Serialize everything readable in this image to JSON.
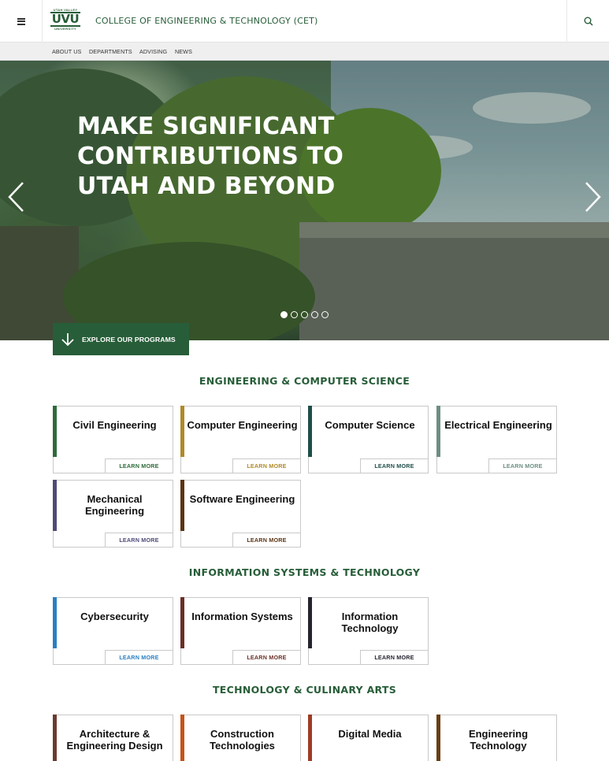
{
  "header": {
    "menu_icon": "hamburger-icon",
    "logo": {
      "top": "UTAH VALLEY",
      "main": "UVU",
      "bottom": "UNIVERSITY"
    },
    "title": "COLLEGE OF ENGINEERING & TECHNOLOGY (CET)",
    "search_icon": "search-icon"
  },
  "subnav": [
    "ABOUT US",
    "DEPARTMENTS",
    "ADVISING",
    "NEWS"
  ],
  "hero": {
    "title": "MAKE SIGNIFICANT CONTRIBUTIONS TO UTAH AND BEYOND",
    "slide_count": 5,
    "active_slide": 1
  },
  "explore_button": {
    "label": "EXPLORE OUR PROGRAMS",
    "icon": "arrow-down-icon"
  },
  "sections": [
    {
      "heading": "ENGINEERING & COMPUTER SCIENCE",
      "cards": [
        {
          "name": "Civil Engineering",
          "learn": "LEARN MORE",
          "color": "#2e6b3a"
        },
        {
          "name": "Computer Engineering",
          "learn": "LEARN MORE",
          "color": "#b08a2a"
        },
        {
          "name": "Computer Science",
          "learn": "LEARN MORE",
          "color": "#1f4e4a"
        },
        {
          "name": "Electrical Engineering",
          "learn": "LEARN MORE",
          "color": "#6e8e82"
        },
        {
          "name": "Mechanical Engineering",
          "learn": "LEARN MORE",
          "color": "#4e4b78"
        },
        {
          "name": "Software Engineering",
          "learn": "LEARN MORE",
          "color": "#5b3414"
        }
      ]
    },
    {
      "heading": "INFORMATION SYSTEMS & TECHNOLOGY",
      "cards": [
        {
          "name": "Cybersecurity",
          "learn": "LEARN MORE",
          "color": "#2b7fc1"
        },
        {
          "name": "Information Systems",
          "learn": "LEARN MORE",
          "color": "#6b2f27"
        },
        {
          "name": "Information Technology",
          "learn": "LEARN MORE",
          "color": "#26232f"
        }
      ]
    },
    {
      "heading": "TECHNOLOGY & CULINARY ARTS",
      "cards": [
        {
          "name": "Architecture & Engineering Design",
          "color": "#6b3a30"
        },
        {
          "name": "Construction Technologies",
          "color": "#c2541c"
        },
        {
          "name": "Digital Media",
          "color": "#9e3c25"
        },
        {
          "name": "Engineering Technology",
          "color": "#6a3f12"
        }
      ]
    }
  ]
}
